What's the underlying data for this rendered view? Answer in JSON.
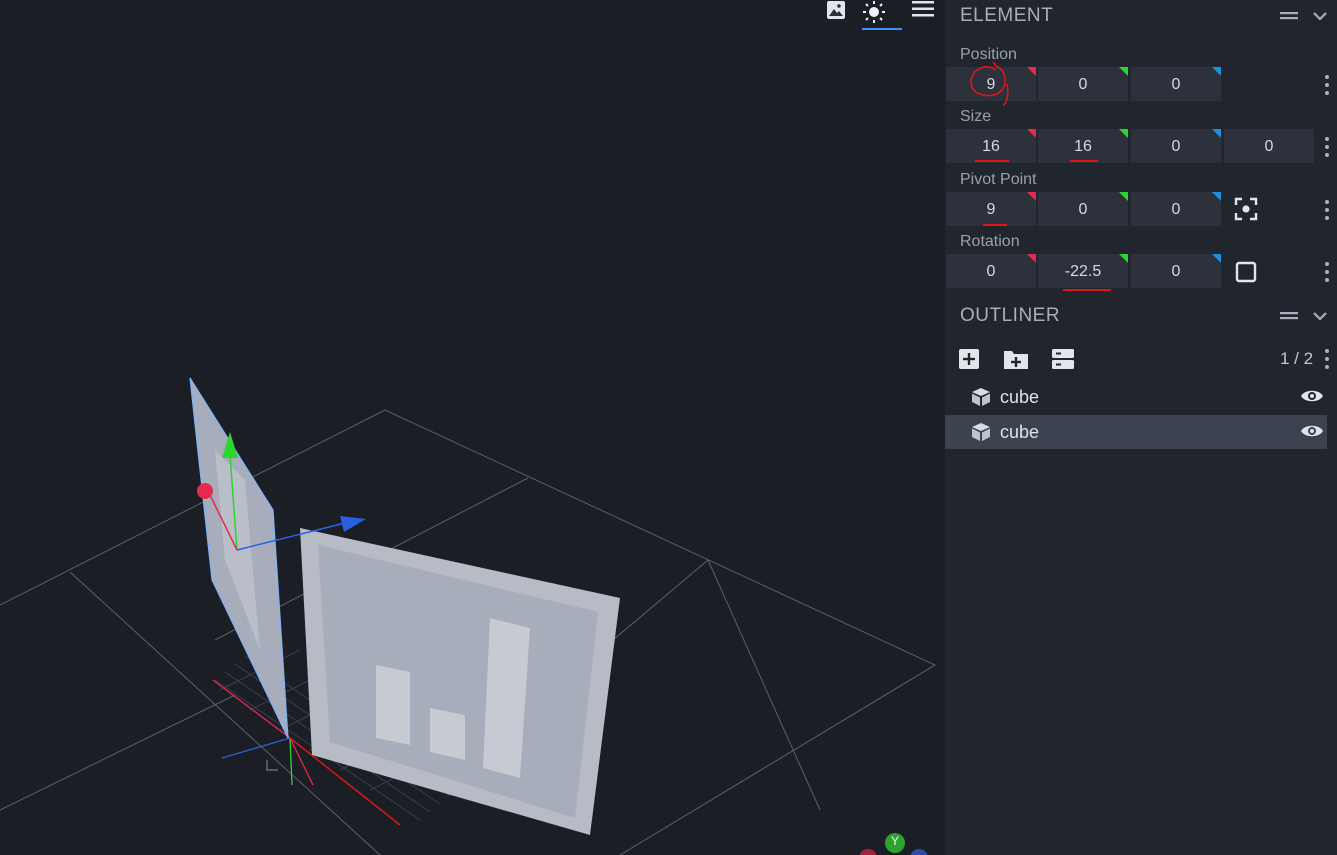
{
  "viewport": {
    "toolbar": {
      "image_icon": "image-icon",
      "light_icon": "sun-icon",
      "menu_icon": "menu-icon"
    },
    "gizmo_y_label": "Y",
    "axis_colors": {
      "x": "#e8294e",
      "y": "#2cd62c",
      "z": "#2960e0"
    }
  },
  "element_panel": {
    "title": "ELEMENT",
    "rows": [
      {
        "label": "Position",
        "values": [
          "9",
          "0",
          "0"
        ]
      },
      {
        "label": "Size",
        "values": [
          "16",
          "16",
          "0",
          "0"
        ]
      },
      {
        "label": "Pivot Point",
        "values": [
          "9",
          "0",
          "0"
        ]
      },
      {
        "label": "Rotation",
        "values": [
          "0",
          "-22.5",
          "0"
        ]
      }
    ]
  },
  "outliner": {
    "title": "OUTLINER",
    "count": "1 / 2",
    "items": [
      {
        "label": "cube",
        "icon": "cube-icon",
        "visible": true,
        "selected": false
      },
      {
        "label": "cube",
        "icon": "cube-icon",
        "visible": true,
        "selected": true
      }
    ]
  },
  "colors": {
    "accent": "#3e90ff",
    "annotation": "#e01616",
    "selection": "#3d4250"
  }
}
